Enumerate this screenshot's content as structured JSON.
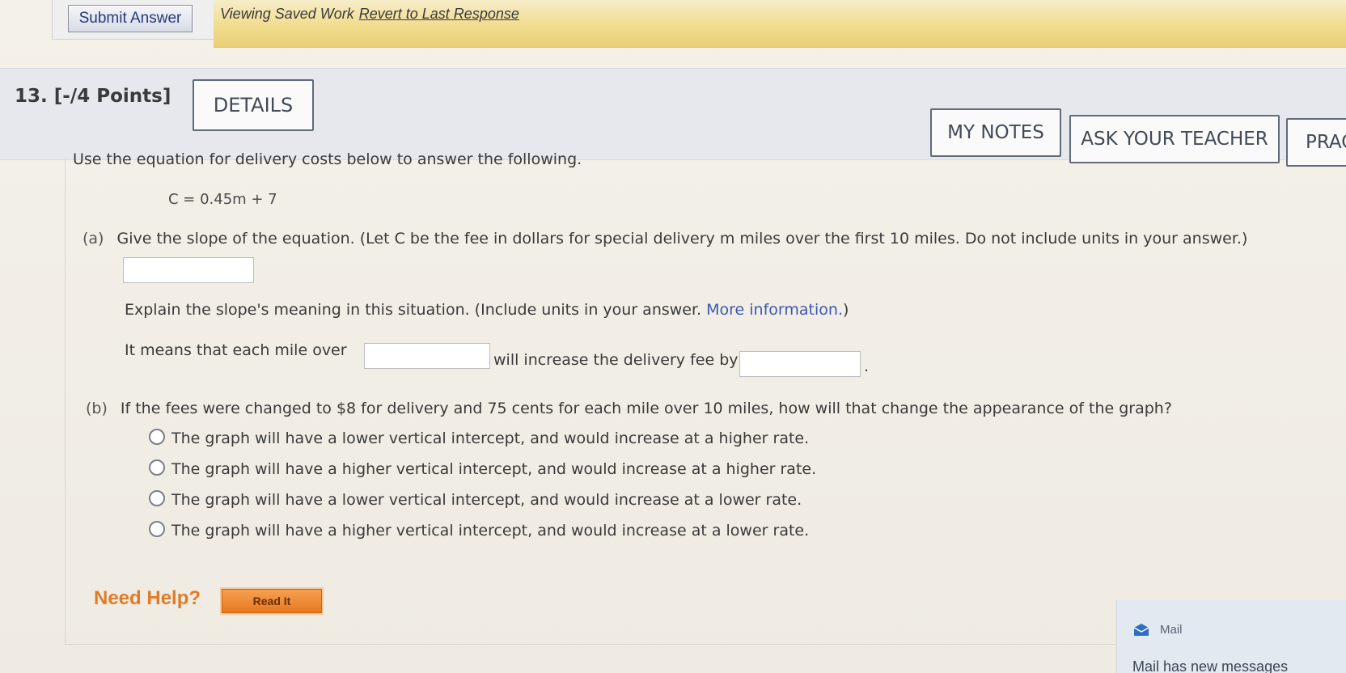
{
  "toolbar": {
    "submit_label": "Submit Answer",
    "saved_text": "Viewing Saved Work",
    "revert_label": "Revert to Last Response"
  },
  "question": {
    "number_label": "13. [-/4 Points]",
    "details_label": "DETAILS",
    "my_notes_label": "MY NOTES",
    "ask_teacher_label": "ASK YOUR TEACHER",
    "practice_label": "PRAC",
    "intro": "Use the equation for delivery costs below to answer the following.",
    "equation": "C = 0.45m + 7",
    "part_a": {
      "label": "(a)",
      "prompt": "Give the slope of the equation. (Let C be the fee in dollars for special delivery m miles over the first 10 miles. Do not include units in your answer.)",
      "slope_value": "",
      "explain_prefix": "Explain the slope's meaning in this situation. (Include units in your answer.",
      "more_info": "More information.",
      "explain_suffix": ")",
      "it_means": "It means that each mile over",
      "will_increase": "will increase the delivery fee by",
      "period": ".",
      "miles_value": "",
      "fee_value": ""
    },
    "part_b": {
      "label": "(b)",
      "prompt": "If the fees were changed to $8 for delivery and 75 cents for each mile over 10 miles, how will that change the appearance of the graph?",
      "options": [
        "The graph will have a lower vertical intercept, and would increase at a higher rate.",
        "The graph will have a higher vertical intercept, and would increase at a higher rate.",
        "The graph will have a lower vertical intercept, and would increase at a lower rate.",
        "The graph will have a higher vertical intercept, and would increase at a lower rate."
      ]
    },
    "need_help": "Need Help?",
    "read_it": "Read It"
  },
  "notification": {
    "app": "Mail",
    "message": "Mail has new messages",
    "icon": "mail-icon"
  },
  "colors": {
    "banner": "#f1dc8f",
    "link": "#3b58b5",
    "help": "#e07b2a",
    "read_it": "#e87920"
  }
}
